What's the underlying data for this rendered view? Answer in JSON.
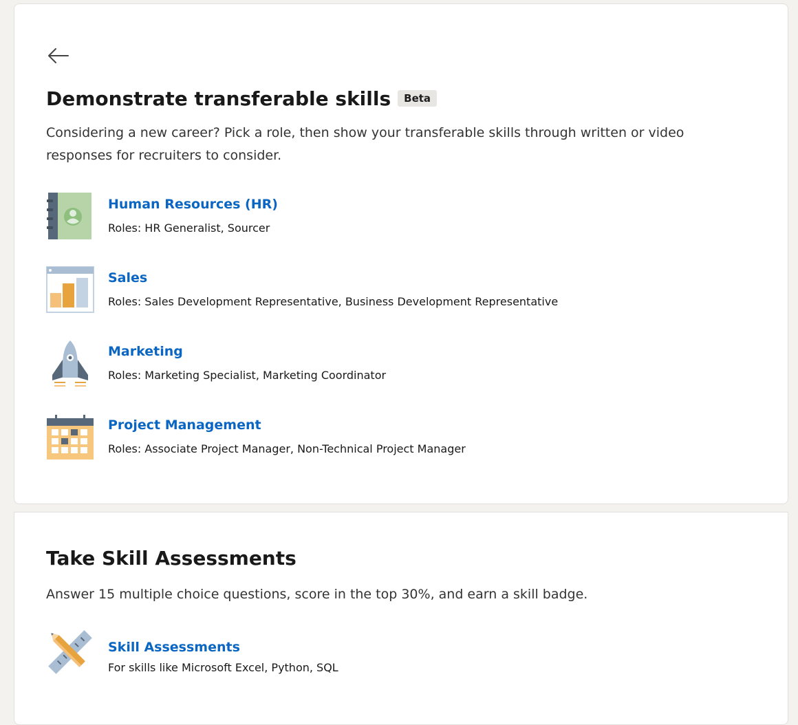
{
  "transferable": {
    "title": "Demonstrate transferable skills",
    "badge": "Beta",
    "description": "Considering a new career? Pick a role, then show your transferable skills through written or video responses for recruiters to consider.",
    "items": [
      {
        "title": "Human Resources (HR)",
        "subtitle": "Roles: HR Generalist, Sourcer",
        "icon": "contact-book-icon"
      },
      {
        "title": "Sales",
        "subtitle": "Roles: Sales Development Representative, Business Development Representative",
        "icon": "bar-chart-icon"
      },
      {
        "title": "Marketing",
        "subtitle": "Roles: Marketing Specialist, Marketing Coordinator",
        "icon": "rocket-icon"
      },
      {
        "title": "Project Management",
        "subtitle": "Roles: Associate Project Manager, Non-Technical Project Manager",
        "icon": "calendar-icon"
      }
    ]
  },
  "assessments": {
    "title": "Take Skill Assessments",
    "description": "Answer 15 multiple choice questions, score in the top 30%, and earn a skill badge.",
    "items": [
      {
        "title": "Skill Assessments",
        "subtitle": "For skills like Microsoft Excel, Python, SQL",
        "icon": "pencil-ruler-icon"
      }
    ]
  },
  "colors": {
    "link": "#0a66c2",
    "page_background": "#f3f2ef",
    "card_background": "#ffffff"
  }
}
